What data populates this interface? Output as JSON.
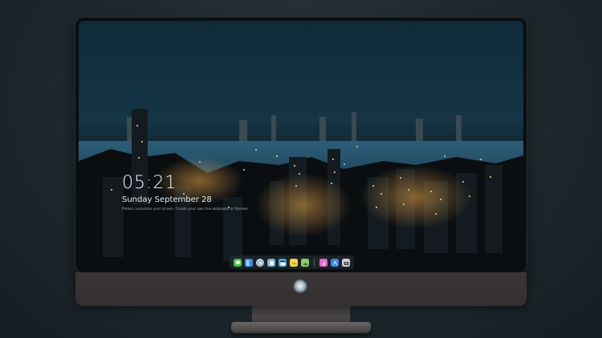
{
  "lockscreen": {
    "time": "05:21",
    "date": "Sunday September 28",
    "hint": "Please customize your screen. Create your own live wallpaper or themes."
  },
  "dock": {
    "apps": [
      {
        "name": "messages-icon",
        "color": "#3fc04a"
      },
      {
        "name": "finder-icon",
        "color": "#3d8fe0"
      },
      {
        "name": "safari-icon",
        "color": "#d8dde2"
      },
      {
        "name": "preview-icon",
        "color": "#7fb2d9"
      },
      {
        "name": "clapper-icon",
        "color": "#4aa8e3"
      },
      {
        "name": "notes-icon",
        "color": "#f4d44d"
      },
      {
        "name": "photos-icon",
        "color": "#8acb6a"
      },
      {
        "name": "itunes-icon",
        "color": "#e36ad0"
      },
      {
        "name": "appstore-icon",
        "color": "#3a86e8"
      },
      {
        "name": "camera-icon",
        "color": "#c9cfd4"
      }
    ]
  },
  "monitor": {
    "logo_icon": "alienware-logo-icon"
  }
}
